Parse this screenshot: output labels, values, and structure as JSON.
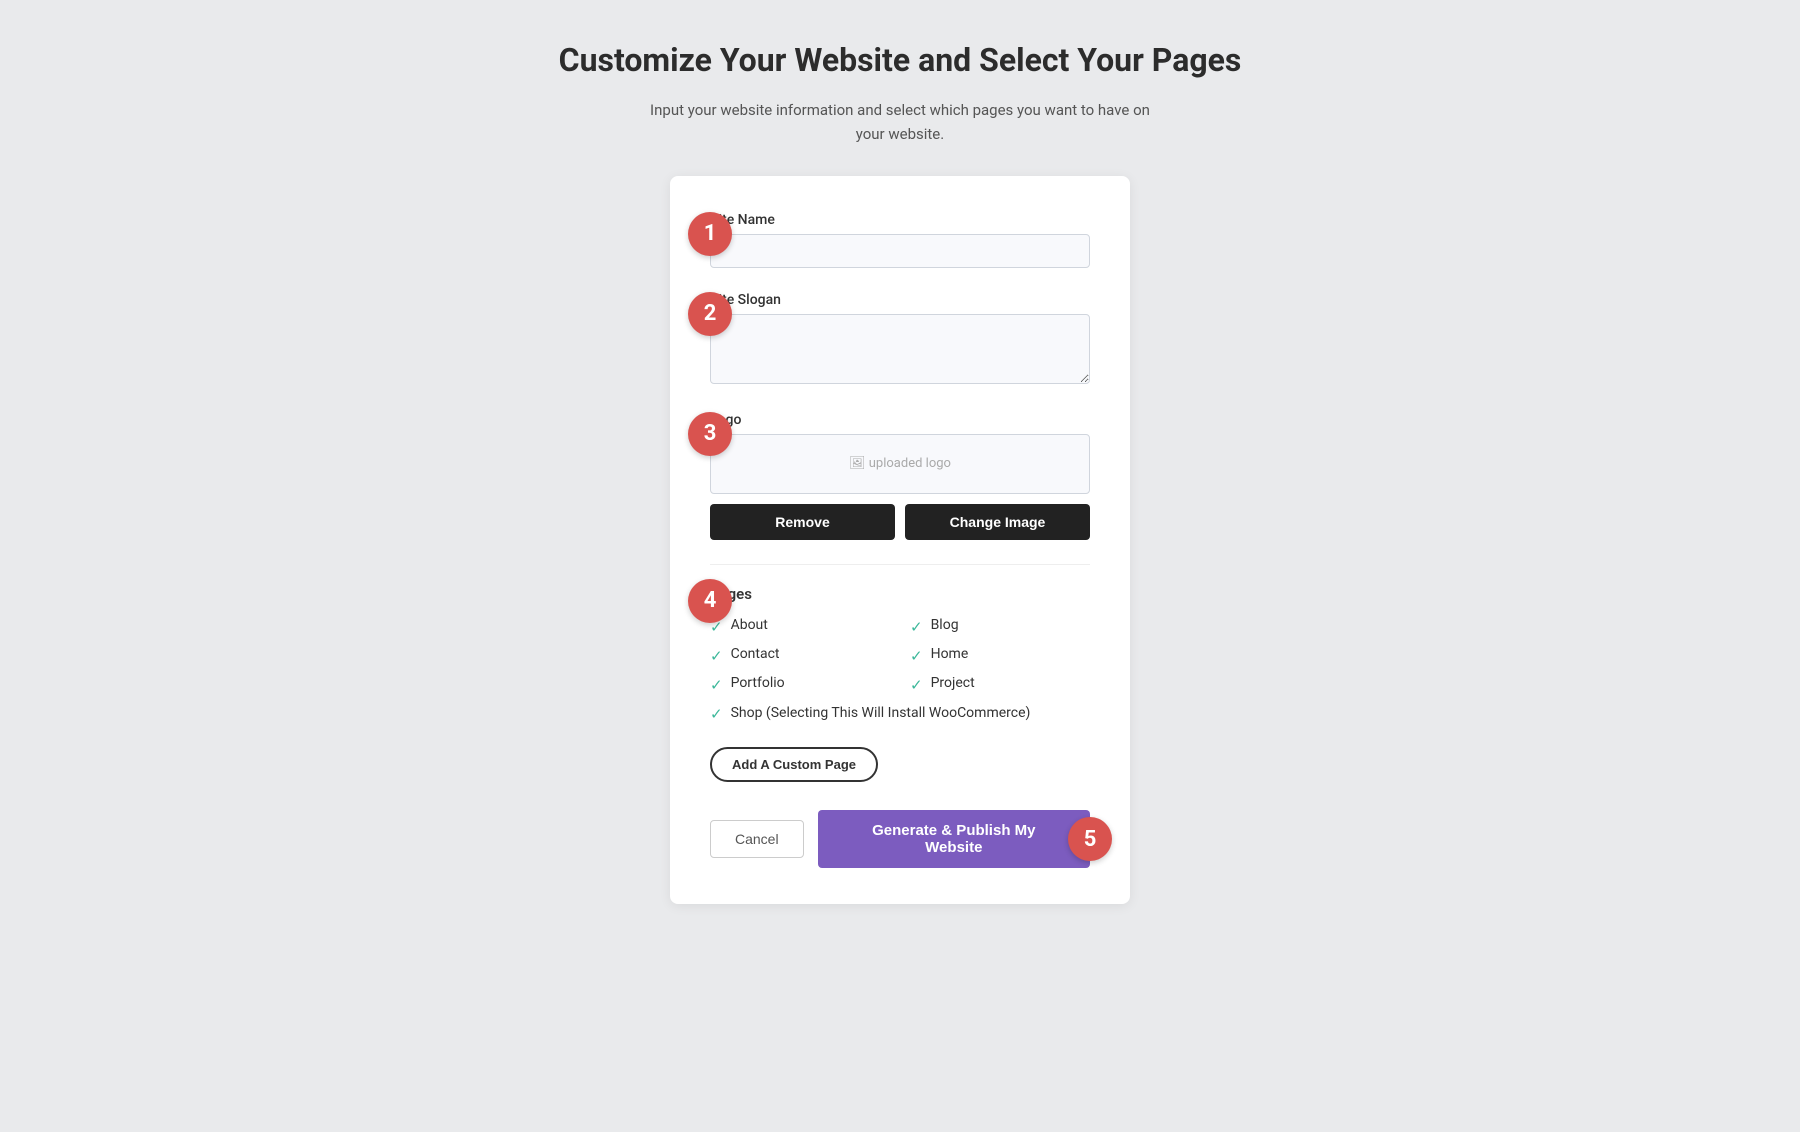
{
  "header": {
    "title": "Customize Your Website and Select Your Pages",
    "subtitle": "Input your website information and select which pages you want to have on your website."
  },
  "form": {
    "site_name_label": "Site Name",
    "site_name_placeholder": "",
    "site_slogan_label": "Site Slogan",
    "site_slogan_placeholder": "",
    "logo_label": "Logo",
    "logo_preview_text": "uploaded logo",
    "remove_button": "Remove",
    "change_image_button": "Change Image",
    "pages_title": "Pages",
    "pages": [
      {
        "label": "About",
        "checked": true,
        "column": 1
      },
      {
        "label": "Blog",
        "checked": true,
        "column": 2
      },
      {
        "label": "Contact",
        "checked": true,
        "column": 1
      },
      {
        "label": "Home",
        "checked": true,
        "column": 2
      },
      {
        "label": "Portfolio",
        "checked": true,
        "column": 1
      },
      {
        "label": "Project",
        "checked": true,
        "column": 2
      }
    ],
    "shop_page_label": "Shop (Selecting This Will Install WooCommerce)",
    "shop_checked": true,
    "add_custom_page_button": "Add A Custom Page",
    "cancel_button": "Cancel",
    "publish_button": "Generate & Publish My Website"
  },
  "steps": {
    "step1": "1",
    "step2": "2",
    "step3": "3",
    "step4": "4",
    "step5": "5"
  }
}
